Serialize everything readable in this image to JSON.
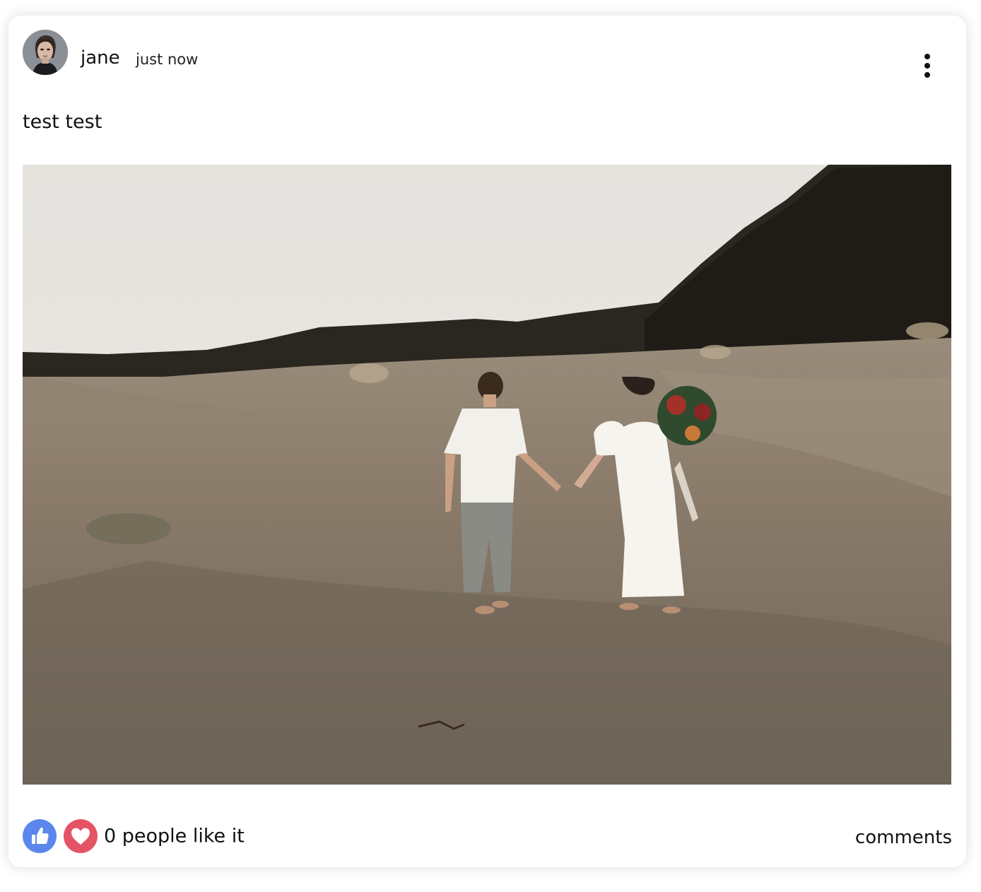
{
  "post": {
    "author": "jane",
    "timestamp": "just now",
    "text": "test test",
    "likes_text": "0 people like it",
    "comments_label": "comments"
  },
  "colors": {
    "like_blue": "#5b87ec",
    "love_red": "#e45465"
  },
  "icons": {
    "menu": "more-vertical-icon",
    "like": "thumbs-up-icon",
    "love": "heart-icon"
  }
}
